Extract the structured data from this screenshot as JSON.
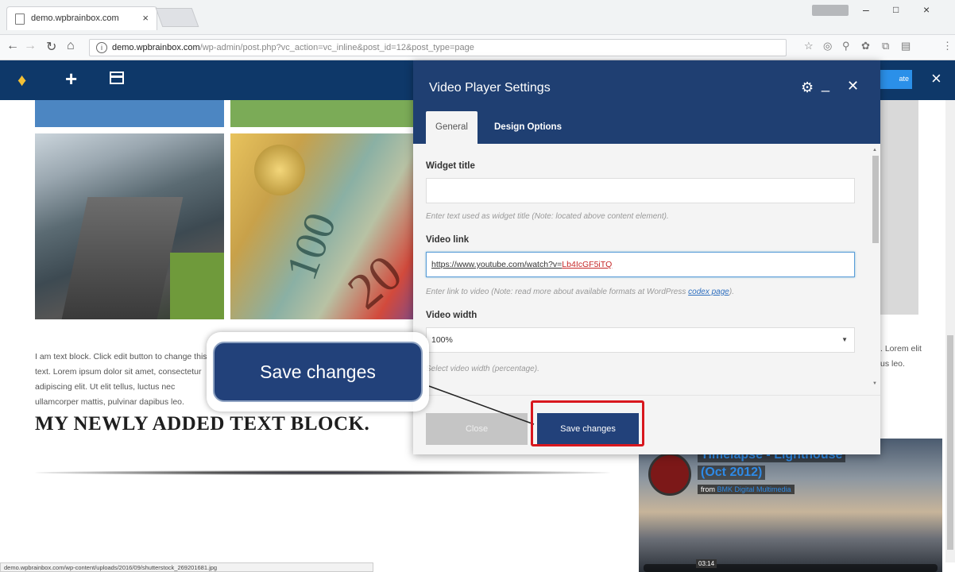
{
  "browser": {
    "tab_title": "demo.wpbrainbox.com",
    "tab_close": "×",
    "window_controls": {
      "minimize": "–",
      "maximize": "□",
      "close": "×"
    },
    "url_host": "demo.wpbrainbox.com",
    "url_path": "/wp-admin/post.php?vc_action=vc_inline&post_id=12&post_type=page",
    "status_url": "demo.wpbrainbox.com/wp-content/uploads/2016/09/shutterstock_269201681.jpg"
  },
  "vc_bar": {
    "add_symbol": "+",
    "update_label": "ate",
    "close_symbol": "×"
  },
  "page": {
    "body_text": "I am text block. Click edit button to change this text. Lorem ipsum dolor sit amet, consectetur adipiscing elit. Ut elit tellus, luctus nec ullamcorper mattis, pulvinar dapibus leo.",
    "heading": "MY NEWLY ADDED TEXT BLOCK.",
    "right_text": ". Lorem elit us leo.",
    "image_numbers": {
      "a": "100",
      "b": "20"
    },
    "video": {
      "title_line1": "Timelapse - Lighthouse",
      "title_line2": "(Oct 2012)",
      "by_prefix": "from",
      "by_name": "BMK Digital Multimedia",
      "time": "03:14"
    }
  },
  "modal": {
    "title": "Video Player Settings",
    "tabs": [
      "General",
      "Design Options"
    ],
    "fields": {
      "widget_title_label": "Widget title",
      "widget_title_value": "",
      "widget_title_hint": "Enter text used as widget title (Note: located above content element).",
      "video_link_label": "Video link",
      "video_link_value_a": "https://www.youtube.com/watch?v=",
      "video_link_value_b": "Lb4IcGF5iTQ",
      "video_link_hint": "Enter link to video (Note: read more about available formats at WordPress ",
      "video_link_hint_link": "codex page",
      "video_link_hint_end": ").",
      "video_width_label": "Video width",
      "video_width_value": "100%",
      "video_width_hint": "Select video width (percentage)."
    },
    "buttons": {
      "close": "Close",
      "save": "Save changes"
    }
  },
  "callout": {
    "label": "Save changes"
  },
  "colors": {
    "accent": "#22417a",
    "highlight": "#d8171e",
    "vc_bar": "#0e3869"
  }
}
